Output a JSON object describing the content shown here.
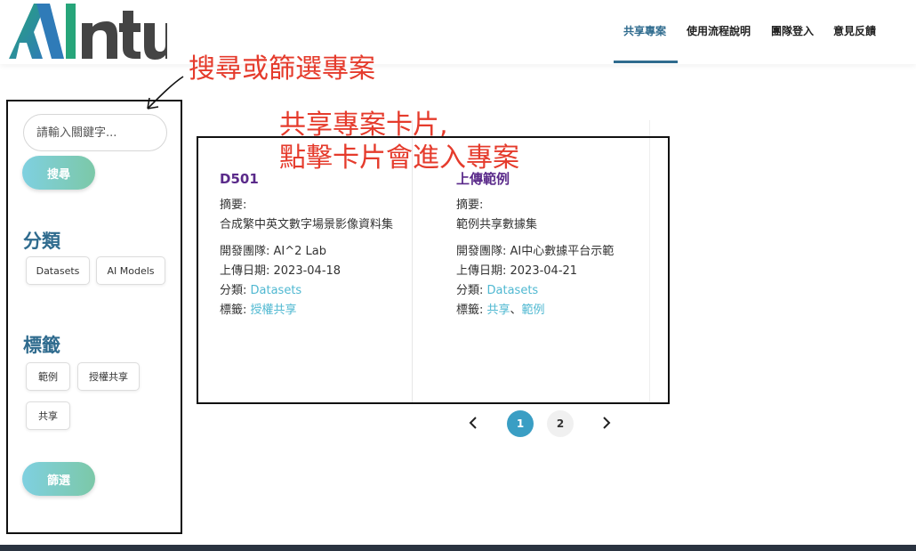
{
  "logo": {
    "text": "AIntu",
    "colors": {
      "primary": "#2f7bb8",
      "secondary": "#27a57a",
      "dark": "#444444"
    }
  },
  "nav": {
    "items": [
      {
        "label": "共享專案",
        "active": true
      },
      {
        "label": "使用流程說明",
        "active": false
      },
      {
        "label": "團隊登入",
        "active": false
      },
      {
        "label": "意見反饋",
        "active": false
      }
    ]
  },
  "annotations": {
    "search": "搜尋或篩選專案",
    "cards_line1": "共享專案卡片,",
    "cards_line2": "點擊卡片會進入專案",
    "color": "#e53b2c"
  },
  "sidebar": {
    "search_placeholder": "請輸入關鍵字...",
    "search_button": "搜尋",
    "category_heading": "分類",
    "categories": [
      "Datasets",
      "AI Models"
    ],
    "tag_heading": "標籤",
    "tags": [
      "範例",
      "授權共享",
      "共享"
    ],
    "filter_button": "篩選"
  },
  "cards": [
    {
      "title": "D501",
      "summary_label": "摘要:",
      "summary": "合成繁中英文數字場景影像資料集",
      "team": "開發團隊: AI^2 Lab",
      "date": "上傳日期: 2023-04-18",
      "category_label": "分類: ",
      "category": "Datasets",
      "tags_label": "標籤: ",
      "tags": "授權共享"
    },
    {
      "title": "上傳範例",
      "summary_label": "摘要:",
      "summary": "範例共享數據集",
      "team": "開發團隊: AI中心數據平台示範",
      "date": "上傳日期: 2023-04-21",
      "category_label": "分類: ",
      "category": "Datasets",
      "tags_label": "標籤: ",
      "tag1": "共享",
      "tag_sep": "、",
      "tag2": "範例"
    }
  ],
  "pagination": {
    "pages": [
      "1",
      "2"
    ],
    "current": "1"
  },
  "colors": {
    "accent": "#2f6b8e",
    "link": "#4fb8d1",
    "card_title": "#5a2a8a",
    "button_gradient_start": "#7fd0e0",
    "button_gradient_end": "#7cc8a8"
  }
}
